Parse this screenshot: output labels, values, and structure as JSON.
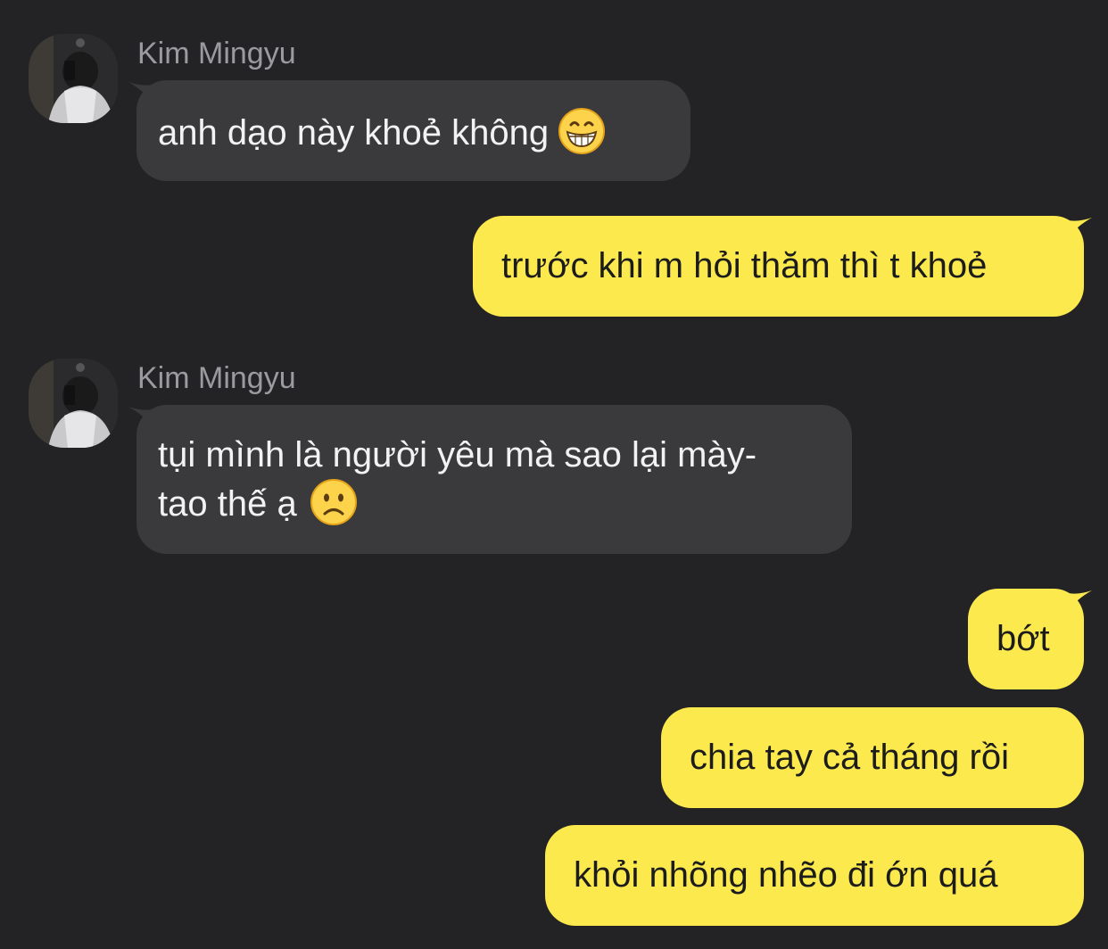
{
  "conversation": {
    "colors": {
      "background": "#232325",
      "incoming_bubble": "#3a3a3c",
      "outgoing_bubble": "#fbe94e",
      "sender_name": "#9b9b9f"
    },
    "messages": [
      {
        "direction": "incoming",
        "sender": "Kim Mingyu",
        "lines": [
          "anh dạo này khoẻ không"
        ],
        "emoji": "grinning-face-emoji"
      },
      {
        "direction": "outgoing",
        "lines": [
          "trước khi m hỏi thăm thì t khoẻ"
        ]
      },
      {
        "direction": "incoming",
        "sender": "Kim Mingyu",
        "lines": [
          "tụi mình là người yêu mà sao lại mày-",
          "tao thế ạ"
        ],
        "emoji": "frowning-face-emoji"
      },
      {
        "direction": "outgoing",
        "lines": [
          "bớt"
        ]
      },
      {
        "direction": "outgoing",
        "lines": [
          "chia tay cả tháng rồi"
        ]
      },
      {
        "direction": "outgoing",
        "lines": [
          "khỏi nhõng nhẽo đi ớn quá"
        ]
      }
    ]
  }
}
